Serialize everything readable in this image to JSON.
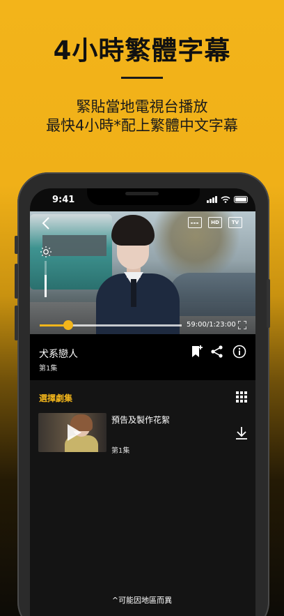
{
  "promo": {
    "headline": "4小時繁體字幕",
    "subline1": "緊貼當地電視台播放",
    "subline2": "最快4小時*配上繁體中文字幕",
    "footnote": "^可能因地區而異"
  },
  "status_bar": {
    "time": "9:41"
  },
  "player": {
    "quality_icons": [
      "subtitles-icon",
      "hd-icon",
      "tv-icon"
    ],
    "hd_label": "HD",
    "tv_label": "TV",
    "time": "59:00/1:23:00",
    "progress": 0.2
  },
  "show": {
    "title": "犬系戀人",
    "episode": "第1集"
  },
  "episodes": {
    "section_title": "選擇劇集",
    "items": [
      {
        "title": "預告及製作花絮",
        "number": "第1集"
      }
    ]
  },
  "colors": {
    "accent": "#f2b51b"
  }
}
